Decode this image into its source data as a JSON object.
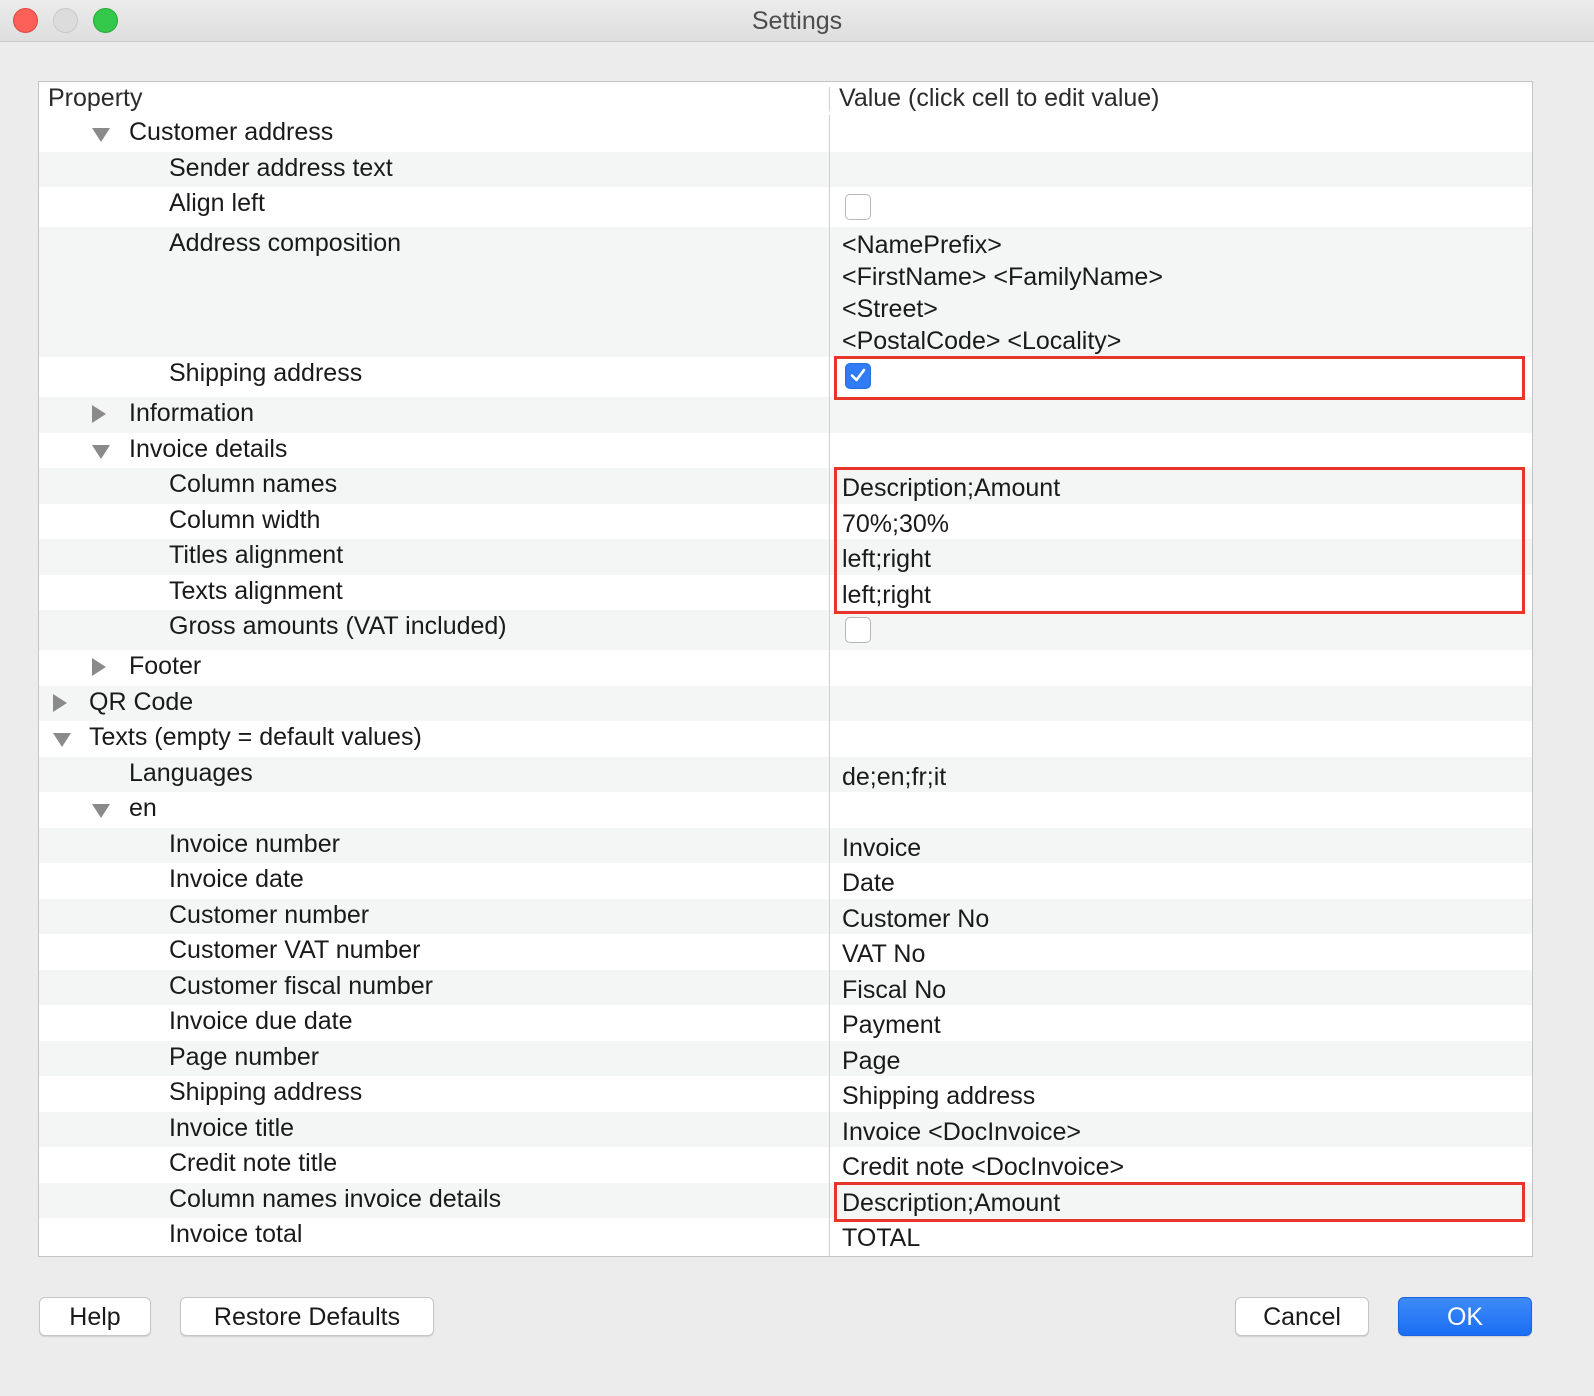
{
  "window": {
    "title": "Settings"
  },
  "table": {
    "header": {
      "property": "Property",
      "value": "Value (click cell to edit value)"
    },
    "rows": [
      {
        "label": "Customer address",
        "depth": 1,
        "toggle": "expanded",
        "value": ""
      },
      {
        "label": "Sender address text",
        "depth": 2,
        "value": ""
      },
      {
        "label": "Align left",
        "depth": 2,
        "checkbox": false
      },
      {
        "label": "Address composition",
        "depth": 2,
        "value_lines": [
          "<NamePrefix>",
          "<FirstName> <FamilyName>",
          "<Street>",
          "<PostalCode> <Locality>"
        ]
      },
      {
        "label": "Shipping address",
        "depth": 2,
        "checkbox": true,
        "highlighted": true
      },
      {
        "label": "Information",
        "depth": 1,
        "toggle": "collapsed",
        "value": ""
      },
      {
        "label": "Invoice details",
        "depth": 1,
        "toggle": "expanded",
        "value": ""
      },
      {
        "label": "Column names",
        "depth": 2,
        "value": "Description;Amount",
        "highlighted": true
      },
      {
        "label": "Column width",
        "depth": 2,
        "value": "70%;30%",
        "highlighted": true
      },
      {
        "label": "Titles alignment",
        "depth": 2,
        "value": "left;right",
        "highlighted": true
      },
      {
        "label": "Texts alignment",
        "depth": 2,
        "value": "left;right",
        "highlighted": true
      },
      {
        "label": "Gross amounts (VAT included)",
        "depth": 2,
        "checkbox": false
      },
      {
        "label": "Footer",
        "depth": 1,
        "toggle": "collapsed",
        "value": ""
      },
      {
        "label": "QR Code",
        "depth": 0,
        "toggle": "collapsed",
        "value": ""
      },
      {
        "label": "Texts (empty = default values)",
        "depth": 0,
        "toggle": "expanded",
        "value": ""
      },
      {
        "label": "Languages",
        "depth": 1,
        "value": "de;en;fr;it"
      },
      {
        "label": "en",
        "depth": 1,
        "toggle": "expanded",
        "value": ""
      },
      {
        "label": "Invoice number",
        "depth": 2,
        "value": "Invoice"
      },
      {
        "label": "Invoice date",
        "depth": 2,
        "value": "Date"
      },
      {
        "label": "Customer number",
        "depth": 2,
        "value": "Customer No"
      },
      {
        "label": "Customer VAT number",
        "depth": 2,
        "value": "VAT No"
      },
      {
        "label": "Customer fiscal number",
        "depth": 2,
        "value": "Fiscal No"
      },
      {
        "label": "Invoice due date",
        "depth": 2,
        "value": "Payment"
      },
      {
        "label": "Page number",
        "depth": 2,
        "value": "Page"
      },
      {
        "label": "Shipping address",
        "depth": 2,
        "value": "Shipping address"
      },
      {
        "label": "Invoice title",
        "depth": 2,
        "value": "Invoice <DocInvoice>"
      },
      {
        "label": "Credit note title",
        "depth": 2,
        "value": "Credit note <DocInvoice>"
      },
      {
        "label": "Column names invoice details",
        "depth": 2,
        "value": "Description;Amount",
        "highlighted": true
      },
      {
        "label": "Invoice total",
        "depth": 2,
        "value": "TOTAL"
      }
    ]
  },
  "buttons": {
    "help": "Help",
    "restore": "Restore Defaults",
    "cancel": "Cancel",
    "ok": "OK"
  },
  "colors": {
    "accent": "#2f7cf6",
    "highlight": "#e8352c",
    "alt_row": "#f4f5f5"
  }
}
